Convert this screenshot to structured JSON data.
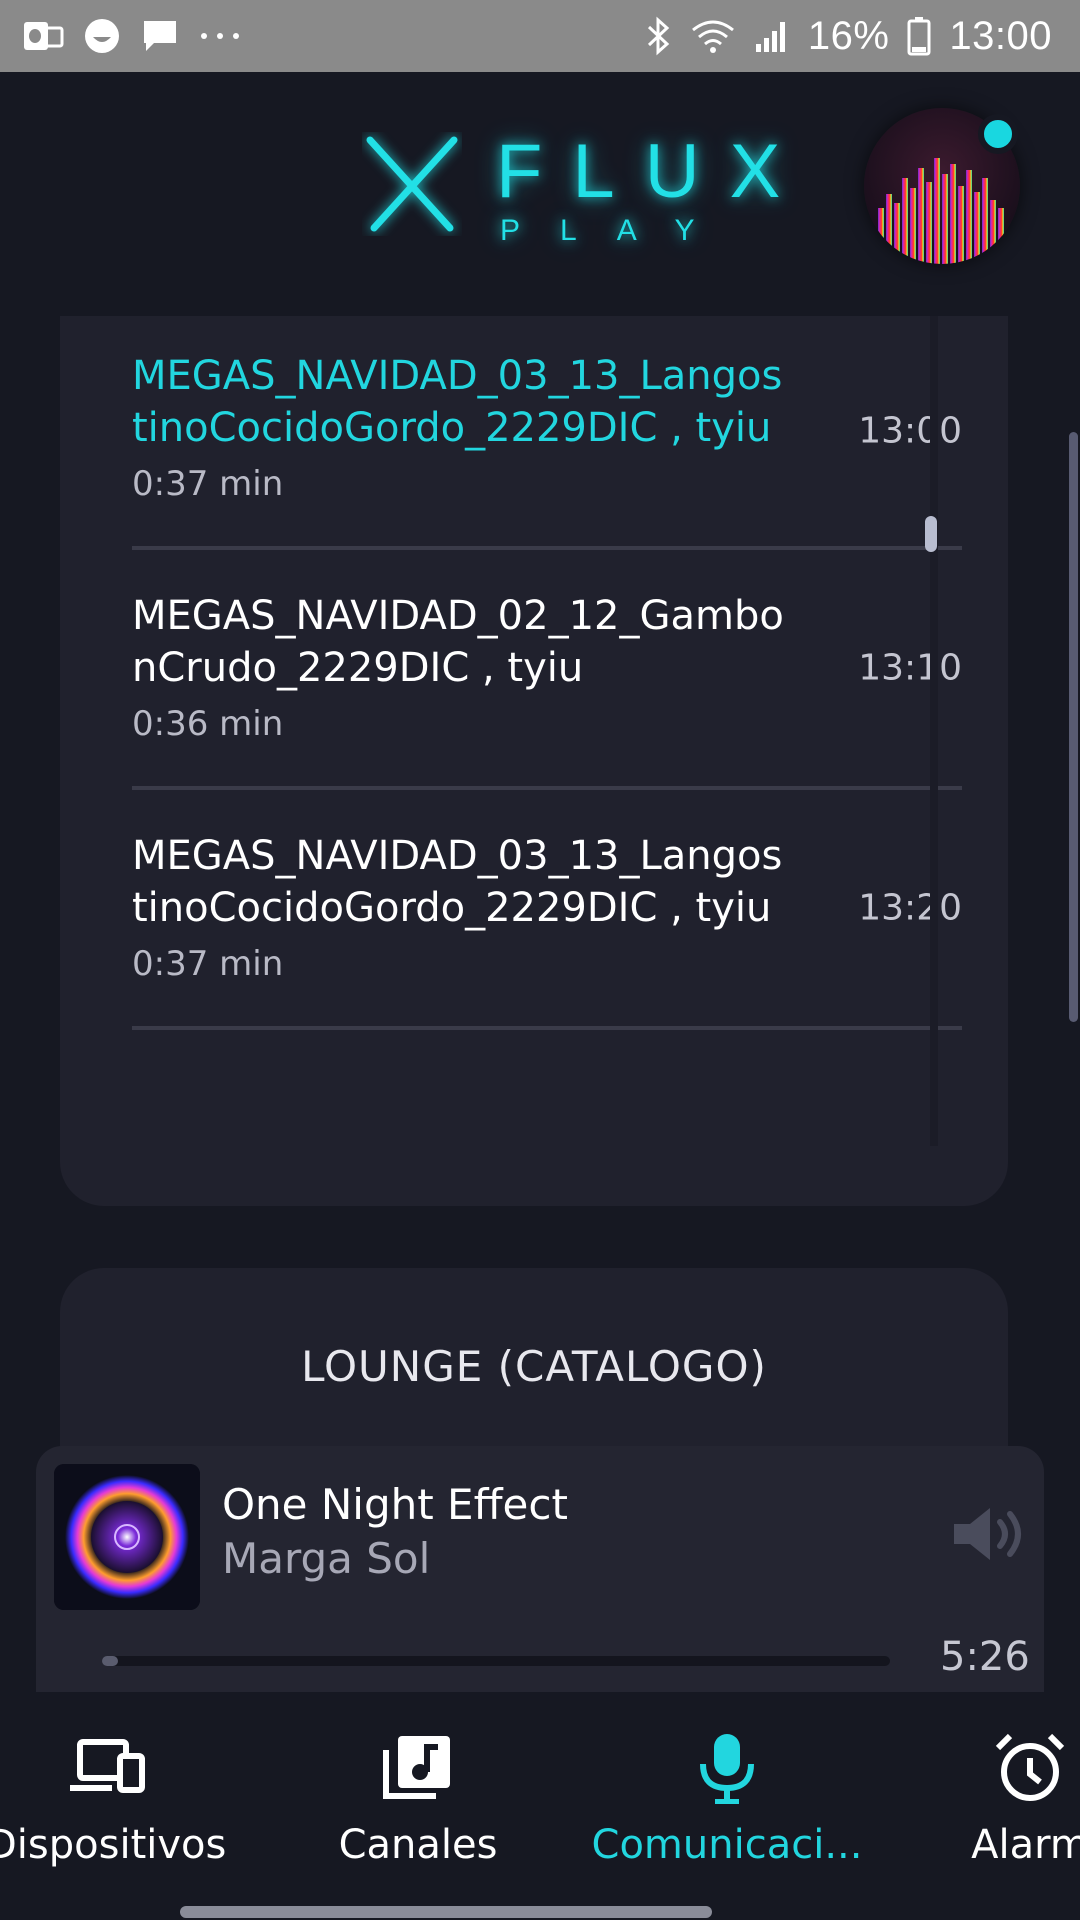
{
  "status_bar": {
    "battery": "16%",
    "time": "13:00",
    "left_icons": [
      "outlook-icon",
      "emoji-icon",
      "message-icon",
      "more-icon"
    ],
    "right_icons": [
      "bluetooth-icon",
      "wifi-icon",
      "signal-icon",
      "battery-icon"
    ]
  },
  "header": {
    "logo_main": "FLUX",
    "logo_sub": "PLAY",
    "accent_color": "#22e0e6"
  },
  "schedule": {
    "items": [
      {
        "title": "MEGAS_NAVIDAD_03_13_LangostinoCocidoGordo_2229DIC , tyiu",
        "duration": "0:37 min",
        "time": "13:00",
        "active": true
      },
      {
        "title": "MEGAS_NAVIDAD_02_12_GambonCrudo_2229DIC , tyiu",
        "duration": "0:36 min",
        "time": "13:10",
        "active": false
      },
      {
        "title": "MEGAS_NAVIDAD_03_13_LangostinoCocidoGordo_2229DIC , tyiu",
        "duration": "0:37 min",
        "time": "13:20",
        "active": false
      }
    ]
  },
  "channel_card": {
    "title": "LOUNGE (CATALOGO)"
  },
  "player": {
    "title": "One Night Effect",
    "artist": "Marga Sol",
    "time": "5:26",
    "progress": 0.02
  },
  "nav": {
    "items": [
      {
        "label": "Dispositivos",
        "icon": "devices-icon",
        "active": false
      },
      {
        "label": "Canales",
        "icon": "music-library-icon",
        "active": false
      },
      {
        "label": "Comunicaci...",
        "icon": "microphone-icon",
        "active": true
      },
      {
        "label": "Alarm",
        "icon": "alarm-icon",
        "active": false
      }
    ]
  }
}
